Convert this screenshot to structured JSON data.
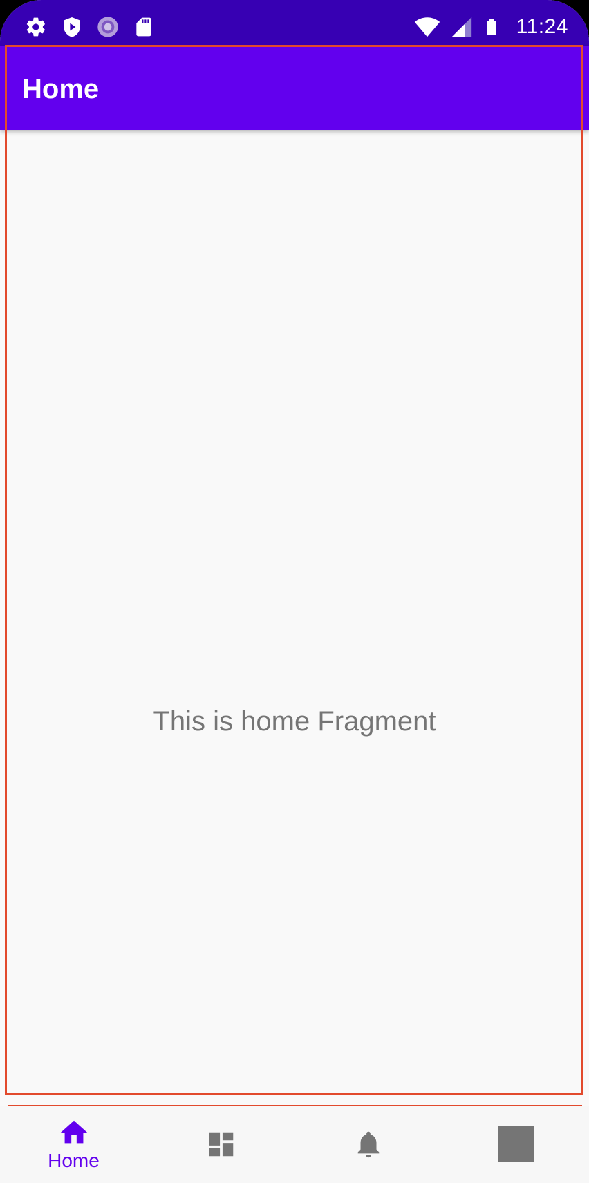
{
  "status_bar": {
    "time": "11:24",
    "left_icons": [
      "settings-icon",
      "play-protect-icon",
      "sync-icon",
      "sd-card-icon"
    ],
    "right_icons": [
      "wifi-icon",
      "cell-signal-icon",
      "battery-icon"
    ]
  },
  "app_bar": {
    "title": "Home"
  },
  "content": {
    "text": "This is home Fragment"
  },
  "bottom_nav": {
    "items": [
      {
        "label": "Home",
        "icon": "home-icon",
        "selected": true
      },
      {
        "label": "",
        "icon": "dashboard-icon",
        "selected": false
      },
      {
        "label": "",
        "icon": "notifications-bell-icon",
        "selected": false
      },
      {
        "label": "",
        "icon": "square-icon",
        "selected": false
      }
    ]
  },
  "colors": {
    "status_bar": "#3700b3",
    "primary": "#6200ee",
    "background": "#f9f9f9",
    "text_secondary": "#757575",
    "icon_inactive": "#757575",
    "highlight_frame": "#e24a2d"
  }
}
